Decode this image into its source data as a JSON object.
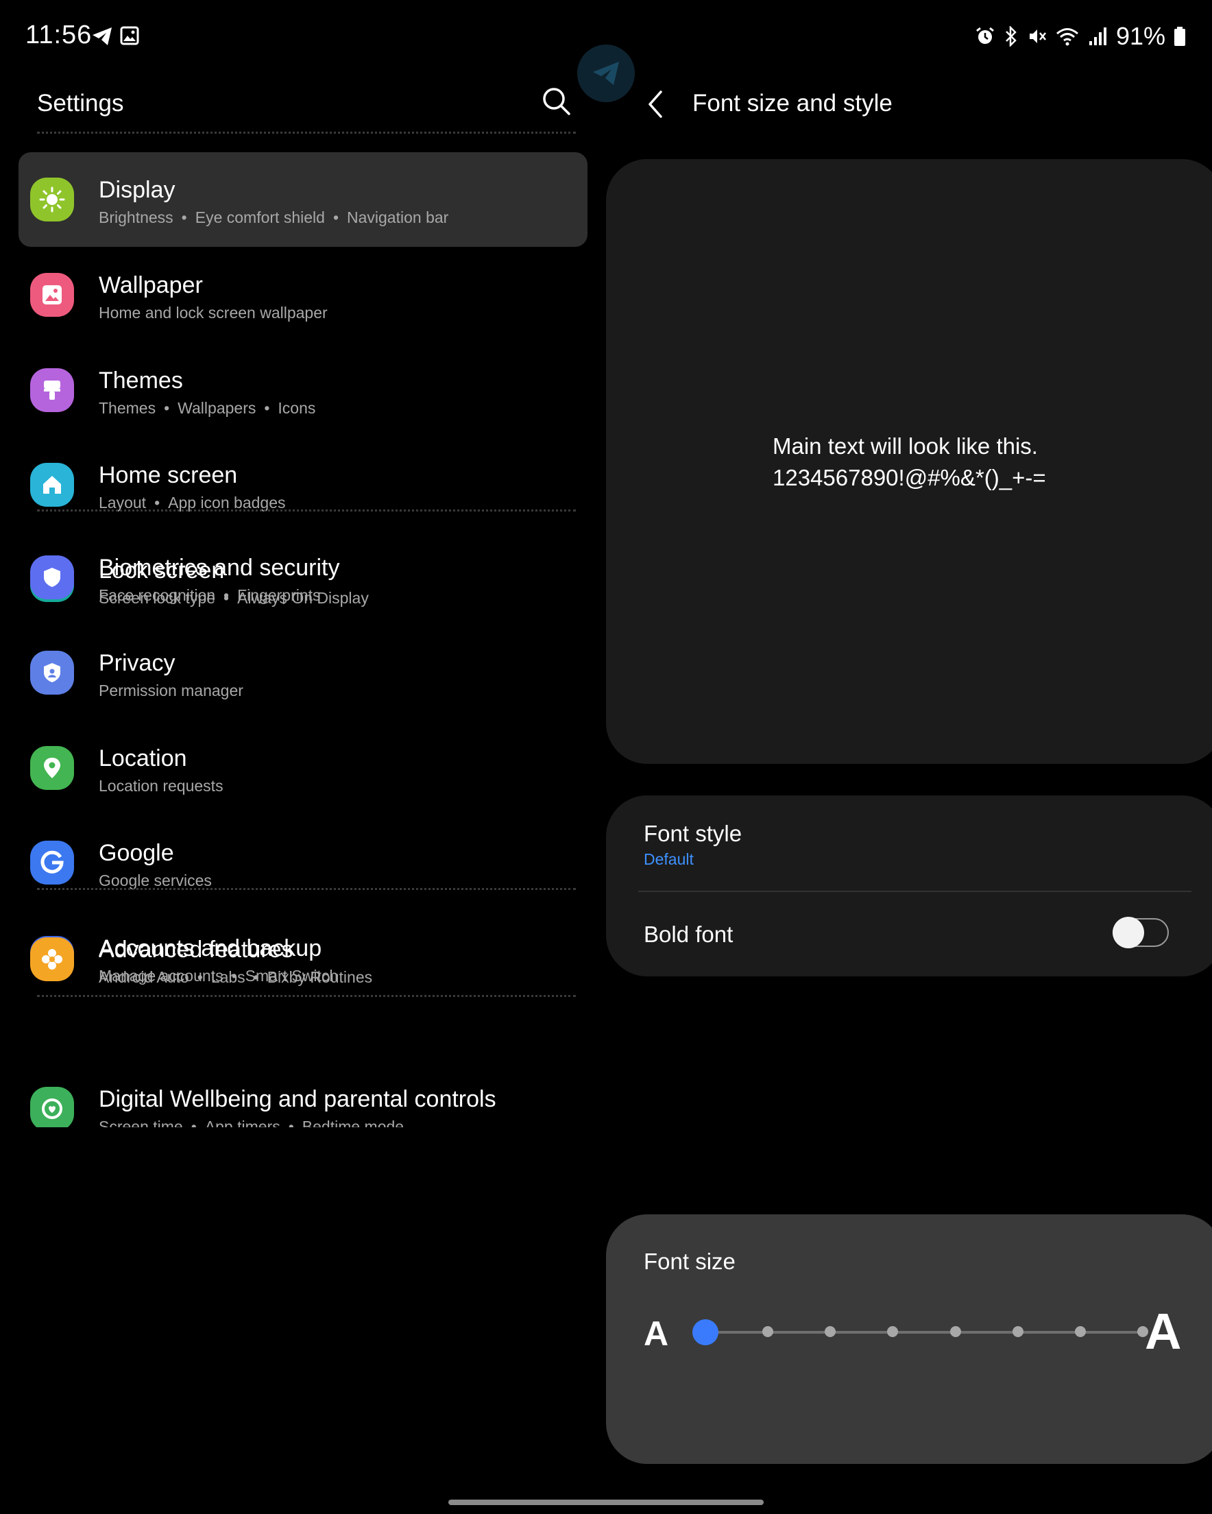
{
  "status": {
    "time": "11:56",
    "battery": "91%"
  },
  "left": {
    "title": "Settings",
    "groups": [
      [
        {
          "title": "Display",
          "subs": [
            "Brightness",
            "Eye comfort shield",
            "Navigation bar"
          ],
          "color": "#8fc52b",
          "icon": "sun-icon",
          "selected": true
        },
        {
          "title": "Wallpaper",
          "subs": [
            "Home and lock screen wallpaper"
          ],
          "color": "#ee5a7e",
          "icon": "wallpaper-icon"
        },
        {
          "title": "Themes",
          "subs": [
            "Themes",
            "Wallpapers",
            "Icons"
          ],
          "color": "#b564dd",
          "icon": "paintbrush-icon"
        },
        {
          "title": "Home screen",
          "subs": [
            "Layout",
            "App icon badges"
          ],
          "color": "#29b4d8",
          "icon": "home-icon"
        },
        {
          "title": "Lock screen",
          "subs": [
            "Screen lock type",
            "Always On Display"
          ],
          "color": "#16a99a",
          "icon": "lock-icon"
        }
      ],
      [
        {
          "title": "Biometrics and security",
          "subs": [
            "Face recognition",
            "Fingerprints"
          ],
          "color": "#5d6ef0",
          "icon": "shield-icon"
        },
        {
          "title": "Privacy",
          "subs": [
            "Permission manager"
          ],
          "color": "#5e7fe6",
          "icon": "privacy-icon"
        },
        {
          "title": "Location",
          "subs": [
            "Location requests"
          ],
          "color": "#43b552",
          "icon": "location-icon"
        },
        {
          "title": "Google",
          "subs": [
            "Google services"
          ],
          "color": "#3c78f0",
          "icon": "google-icon"
        },
        {
          "title": "Accounts and backup",
          "subs": [
            "Manage accounts",
            "Smart Switch"
          ],
          "color": "#3f67e6",
          "icon": "sync-icon"
        }
      ],
      [
        {
          "title": "Advanced features",
          "subs": [
            "Android Auto",
            "Labs",
            "Bixby Routines"
          ],
          "color": "#f5a524",
          "icon": "advanced-icon"
        }
      ],
      [
        {
          "title": "Digital Wellbeing and parental controls",
          "subs": [
            "Screen time",
            "App timers",
            "Bedtime mode"
          ],
          "color": "#3cb05a",
          "icon": "wellbeing-icon"
        }
      ]
    ]
  },
  "right": {
    "title": "Font size and style",
    "preview_line1": "Main text will look like this.",
    "preview_line2": "1234567890!@#%&*()_+-=",
    "font_style_label": "Font style",
    "font_style_value": "Default",
    "bold_font_label": "Bold font",
    "bold_font_on": false,
    "font_size_label": "Font size",
    "font_size_small_glyph": "A",
    "font_size_large_glyph": "A",
    "font_size_level": 1,
    "font_size_levels": 8
  }
}
